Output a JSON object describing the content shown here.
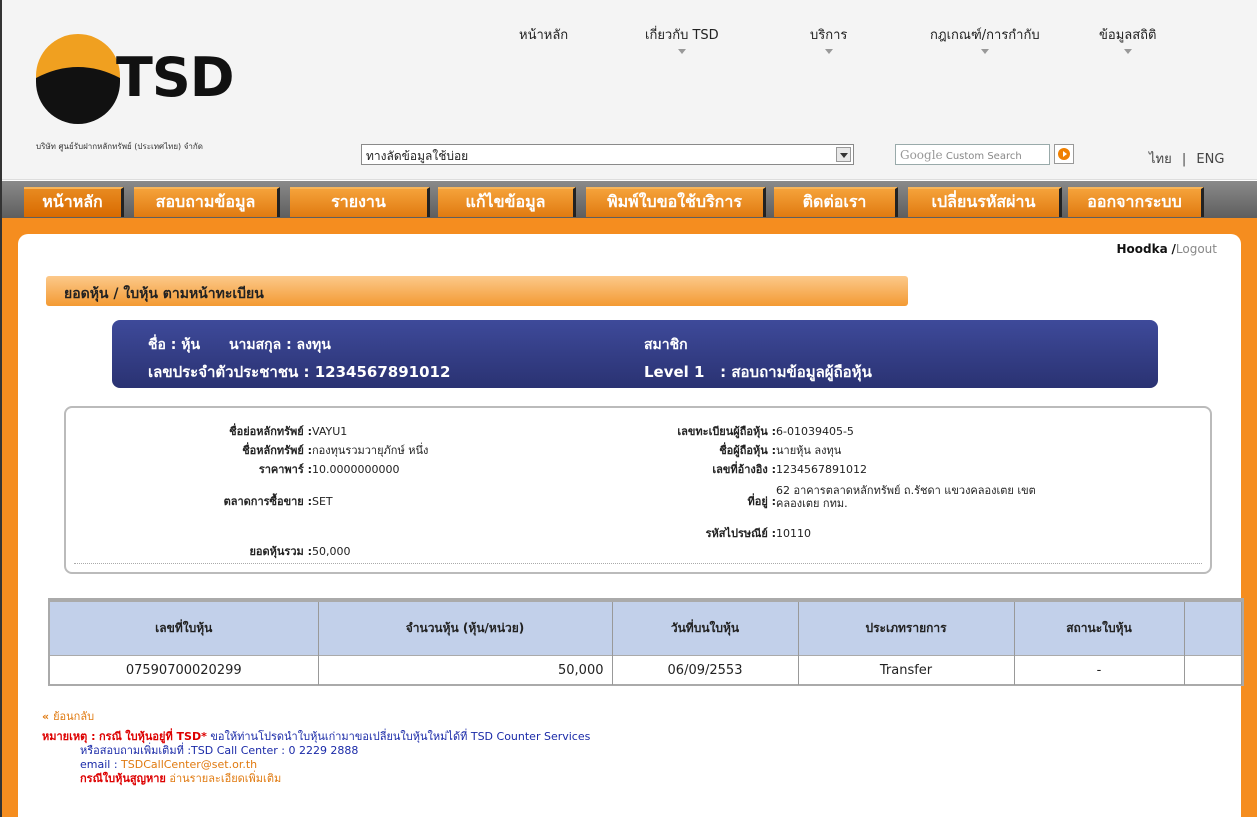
{
  "header": {
    "logo_text": "TSD",
    "company_name": "บริษัท ศูนย์รับฝากหลักทรัพย์ (ประเทศไทย) จำกัด",
    "top_nav": [
      {
        "label": "หน้าหลัก",
        "has_menu": false
      },
      {
        "label": "เกี่ยวกับ TSD",
        "has_menu": true
      },
      {
        "label": "บริการ",
        "has_menu": true
      },
      {
        "label": "กฎเกณฑ์/การกำกับ",
        "has_menu": true
      },
      {
        "label": "ข้อมูลสถิติ",
        "has_menu": true
      }
    ],
    "quicklinks_value": "ทางลัดข้อมูลใช้บ่อย",
    "search_placeholder_brand": "Google",
    "search_placeholder": "Custom Search",
    "lang_th": "ไทย",
    "lang_sep": "|",
    "lang_en": "ENG"
  },
  "tabs": [
    {
      "label": "หน้าหลัก"
    },
    {
      "label": "สอบถามข้อมูล"
    },
    {
      "label": "รายงาน"
    },
    {
      "label": "แก้ไขข้อมูล"
    },
    {
      "label": "พิมพ์ใบขอใช้บริการ"
    },
    {
      "label": "ติดต่อเรา"
    },
    {
      "label": "เปลี่ยนรหัสผ่าน"
    },
    {
      "label": "ออกจากระบบ"
    }
  ],
  "user": {
    "name": "Hoodka",
    "logout_sep": "/",
    "logout": "Logout"
  },
  "section_title": "ยอดหุ้น / ใบหุ้น ตามหน้าทะเบียน",
  "member": {
    "first_name_label": "ชื่อ : หุ้น",
    "last_name_label": "นามสกุล : ลงทุน",
    "id_label": "เลขประจำตัวประชาชน : 1234567891012",
    "membership": "สมาชิก",
    "level": "Level 1",
    "level_desc": ": สอบถามข้อมูลผู้ถือหุ้น"
  },
  "details": {
    "left": [
      {
        "k": "ชื่อย่อหลักทรัพย์ :",
        "v": "VAYU1"
      },
      {
        "k": "ชื่อหลักทรัพย์ :",
        "v": "กองทุนรวมวายุภักษ์ หนึ่ง"
      },
      {
        "k": "ราคาพาร์ :",
        "v": "10.0000000000"
      },
      {
        "k": "ตลาดการซื้อขาย :",
        "v": "SET"
      },
      {
        "k": "ยอดหุ้นรวม :",
        "v": "50,000"
      }
    ],
    "right": [
      {
        "k": "เลขทะเบียนผู้ถือหุ้น :",
        "v": "6-01039405-5"
      },
      {
        "k": "ชื่อผู้ถือหุ้น :",
        "v": "นายหุ้น ลงทุน"
      },
      {
        "k": "เลขที่อ้างอิง :",
        "v": "1234567891012"
      },
      {
        "k": "ที่อยู่ :",
        "v": "62 อาคารตลาดหลักทรัพย์ ถ.รัชดา แขวงคลองเตย เขต",
        "v2": "คลองเตย กทม."
      },
      {
        "k": "รหัสไปรษณีย์ :",
        "v": "10110"
      }
    ]
  },
  "table": {
    "headers": [
      "เลขที่ใบหุ้น",
      "จำนวนหุ้น (หุ้น/หน่วย)",
      "วันที่บนใบหุ้น",
      "ประเภทรายการ",
      "สถานะใบหุ้น"
    ],
    "rows": [
      {
        "cert_no": "07590700020299",
        "shares": "50,000",
        "date": "06/09/2553",
        "type": "Transfer",
        "status": "-"
      }
    ]
  },
  "notes": {
    "back": "ย้อนกลับ",
    "note_label": "หมายเหตุ :",
    "note_case": "กรณี",
    "note_tsd": "ใบหุ้นอยู่ที่ TSD*",
    "note_text": "ขอให้ท่านโปรดนำใบหุ้นเก่ามาขอเปลี่ยนใบหุ้นใหม่ได้ที่ TSD Counter Services",
    "note_line2": "หรือสอบถามเพิ่มเติมที่ :TSD Call Center : 0 2229 2888",
    "email_label": "email :",
    "email": "TSDCallCenter@set.or.th",
    "lost_case": "กรณีใบหุ้นสูญหาย",
    "lost_more": "อ่านรายละเอียดเพิ่มเติม"
  },
  "colors": {
    "tab_orange": "#f58d1f",
    "member_navy": "#2f3a80",
    "table_header": "#c2d0ea",
    "note_red": "#dd0000",
    "note_blue": "#1a2aa8"
  }
}
